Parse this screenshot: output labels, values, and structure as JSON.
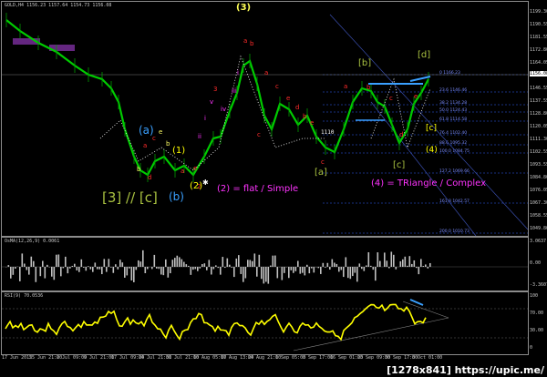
{
  "chart": {
    "symbol_label": "GOLD,H4 1156.23 1157.64 1154.73 1156.08",
    "last_price_tag": "1156.08",
    "price_axis": [
      "1199.30",
      "1190.55",
      "1181.55",
      "1172.80",
      "1164.05",
      "1155.30",
      "1146.55",
      "1137.55",
      "1128.80",
      "1120.05",
      "1111.30",
      "1102.55",
      "1093.55",
      "1084.80",
      "1076.05",
      "1067.30",
      "1058.55",
      "1049.80"
    ],
    "time_axis": [
      "17 Jun 2015",
      "25 Jun 21:00",
      "2 Jul 09:00",
      "9 Jul 21:00",
      "17 Jul 09:00",
      "24 Jul 21:00",
      "31 Jul 21:00",
      "10 Aug 05:00",
      "17 Aug 13:00",
      "24 Aug 21:00",
      "1 Sep 05:00",
      "8 Sep 17:00",
      "16 Sep 01:00",
      "23 Sep 09:00",
      "30 Sep 17:00",
      "8 Oct 01:00"
    ]
  },
  "annotations": {
    "wave_3_top": "(3)",
    "wave_a_circle": "(a)",
    "wave_b_circle": "(b)",
    "wave_2_circle": "(2)",
    "wave_1_circle": "(1)",
    "big_3c": "[3] // [c]",
    "flat_simple": "(2) = flat / Simple",
    "triangle_complex": "(4) = TRiangle / Complex",
    "bracket_a": "[a]",
    "bracket_b": "[b]",
    "bracket_c": "[c]",
    "bracket_d": "[d]",
    "paren_4": "(4)",
    "label_c": "[c]",
    "price_1110": "1110"
  },
  "fib_levels": [
    {
      "label": "0 1166.23"
    },
    {
      "label": "23.6 1146.46"
    },
    {
      "label": "38.2 1134.28"
    },
    {
      "label": "50.0 1124.43"
    },
    {
      "label": "61.8 1114.58"
    },
    {
      "label": "76.4 1102.40"
    },
    {
      "label": "88.6 1095.32"
    },
    {
      "label": "100.0 1084.75"
    },
    {
      "label": "127.2 1069.66"
    },
    {
      "label": "161.8 1042.57"
    },
    {
      "label": "200.0 1010.73"
    }
  ],
  "osma": {
    "label": "OsMA(12,26,9) 0.0061",
    "axis": [
      "3.0637",
      "0.00",
      "-3.3607"
    ]
  },
  "rsi": {
    "label": "RSI(9) 70.0536",
    "axis": [
      "100",
      "70.00",
      "30.00",
      "0"
    ]
  },
  "watermark": "[1278x841] https://upic.me/",
  "colors": {
    "price_line": "#00cc00",
    "fib": "#2f5fff",
    "wave_red": "#ff2b2b",
    "wave_magenta": "#ff33ff",
    "wave_yellow": "#ffff00",
    "wave_blue": "#3aa0ff",
    "wave_olive": "#a8c040",
    "rsi_line": "#ffff00"
  }
}
